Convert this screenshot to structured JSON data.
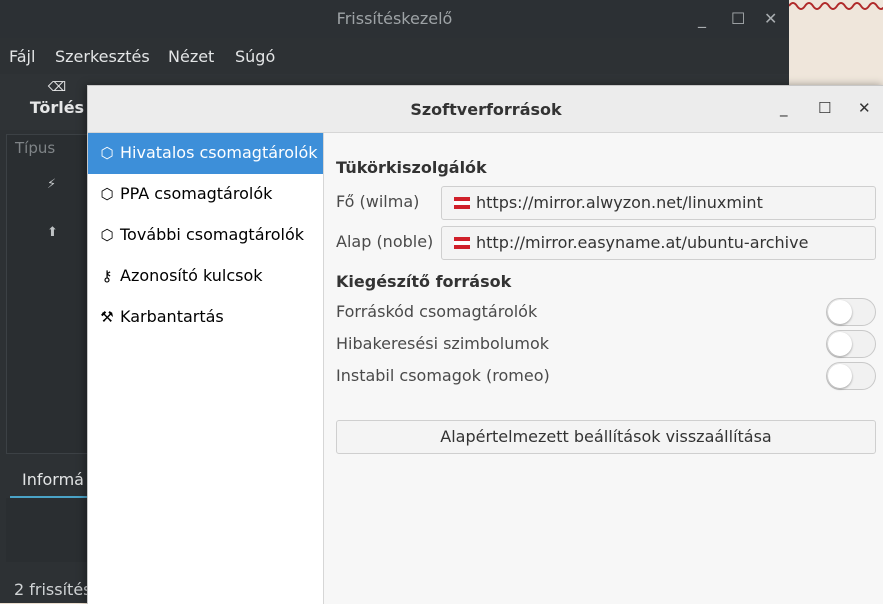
{
  "background_app": {
    "title": "Frissítéskezelő",
    "window_controls": {
      "minimize": "_",
      "maximize": "☐",
      "close": "✕"
    },
    "menu": [
      "Fájl",
      "Szerkesztés",
      "Nézet",
      "Súgó"
    ],
    "toolbar": {
      "delete_label": "Törlés",
      "delete_icon": "⌫"
    },
    "list": {
      "column_type": "Típus",
      "row_icons": [
        "⚡",
        "⬆"
      ]
    },
    "info_tab": "Informá",
    "status": "2 frissítés"
  },
  "dialog": {
    "title": "Szoftverforrások",
    "window_controls": {
      "minimize": "_",
      "maximize": "☐",
      "close": "✕"
    },
    "sidebar": [
      {
        "label": "Hivatalos csomagtárolók",
        "icon": "package-icon",
        "glyph": "⬡",
        "active": true
      },
      {
        "label": "PPA csomagtárolók",
        "icon": "package-icon",
        "glyph": "⬡",
        "active": false
      },
      {
        "label": "További csomagtárolók",
        "icon": "package-icon",
        "glyph": "⬡",
        "active": false
      },
      {
        "label": "Azonosító kulcsok",
        "icon": "key-icon",
        "glyph": "⚷",
        "active": false
      },
      {
        "label": "Karbantartás",
        "icon": "maintenance-icon",
        "glyph": "⚒",
        "active": false
      }
    ],
    "mirrors": {
      "title": "Tükörkiszolgálók",
      "main_label": "Fő (wilma)",
      "main_url": "https://mirror.alwyzon.net/linuxmint",
      "base_label": "Alap (noble)",
      "base_url": "http://mirror.easyname.at/ubuntu-archive",
      "flag_colors": [
        "#d0202a",
        "#ffffff",
        "#d0202a"
      ]
    },
    "optional": {
      "title": "Kiegészítő források",
      "toggles": [
        {
          "label": "Forráskód csomagtárolók",
          "on": false
        },
        {
          "label": "Hibakeresési szimbolumok",
          "on": false
        },
        {
          "label": "Instabil csomagok (romeo)",
          "on": false
        }
      ]
    },
    "reset_button": "Alapértelmezett beállítások visszaállítása",
    "accent_color": "#3d8fd9"
  }
}
